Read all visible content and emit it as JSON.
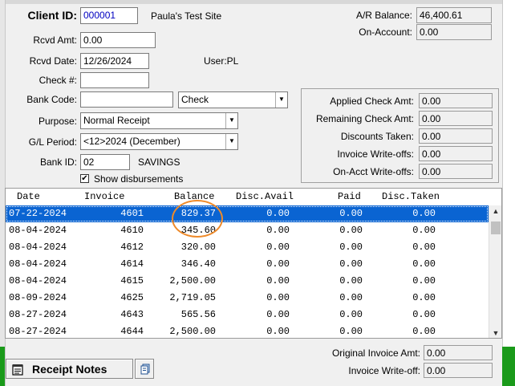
{
  "client": {
    "id_label": "Client ID:",
    "id_value": "000001",
    "site_name": "Paula's Test Site"
  },
  "balances": {
    "ar_label": "A/R Balance:",
    "ar_value": "46,400.61",
    "onaccount_label": "On-Account:",
    "onaccount_value": "0.00"
  },
  "form": {
    "rcvd_amt_label": "Rcvd Amt:",
    "rcvd_amt_value": "0.00",
    "rcvd_date_label": "Rcvd Date:",
    "rcvd_date_value": "12/26/2024",
    "user_text": "User:PL",
    "check_label": "Check #:",
    "check_value": "",
    "bank_code_label": "Bank Code:",
    "bank_code_value": "",
    "payment_type": "Check",
    "purpose_label": "Purpose:",
    "purpose_value": "Normal Receipt",
    "gl_period_label": "G/L Period:",
    "gl_period_value": "<12>2024 (December)",
    "bank_id_label": "Bank ID:",
    "bank_id_value": "02",
    "bank_name": "SAVINGS",
    "show_disb_label": "Show disbursements",
    "show_disb_checked": "✔"
  },
  "summary": {
    "applied_label": "Applied Check Amt:",
    "applied_value": "0.00",
    "remaining_label": "Remaining Check Amt:",
    "remaining_value": "0.00",
    "discounts_label": "Discounts Taken:",
    "discounts_value": "0.00",
    "inv_wo_label": "Invoice Write-offs:",
    "inv_wo_value": "0.00",
    "onacct_wo_label": "On-Acct Write-offs:",
    "onacct_wo_value": "0.00"
  },
  "grid": {
    "headers": {
      "date": "Date",
      "invoice": "Invoice",
      "balance": "Balance",
      "disc_avail": "Disc.Avail",
      "paid": "Paid",
      "disc_taken": "Disc.Taken"
    },
    "rows": [
      {
        "date": "07-22-2024",
        "invoice": "4601",
        "balance": "829.37",
        "disc_avail": "0.00",
        "paid": "0.00",
        "disc_taken": "0.00"
      },
      {
        "date": "08-04-2024",
        "invoice": "4610",
        "balance": "345.60",
        "disc_avail": "0.00",
        "paid": "0.00",
        "disc_taken": "0.00"
      },
      {
        "date": "08-04-2024",
        "invoice": "4612",
        "balance": "320.00",
        "disc_avail": "0.00",
        "paid": "0.00",
        "disc_taken": "0.00"
      },
      {
        "date": "08-04-2024",
        "invoice": "4614",
        "balance": "346.40",
        "disc_avail": "0.00",
        "paid": "0.00",
        "disc_taken": "0.00"
      },
      {
        "date": "08-04-2024",
        "invoice": "4615",
        "balance": "2,500.00",
        "disc_avail": "0.00",
        "paid": "0.00",
        "disc_taken": "0.00"
      },
      {
        "date": "08-09-2024",
        "invoice": "4625",
        "balance": "2,719.05",
        "disc_avail": "0.00",
        "paid": "0.00",
        "disc_taken": "0.00"
      },
      {
        "date": "08-27-2024",
        "invoice": "4643",
        "balance": "565.56",
        "disc_avail": "0.00",
        "paid": "0.00",
        "disc_taken": "0.00"
      },
      {
        "date": "08-27-2024",
        "invoice": "4644",
        "balance": "2,500.00",
        "disc_avail": "0.00",
        "paid": "0.00",
        "disc_taken": "0.00"
      }
    ]
  },
  "footer": {
    "orig_inv_label": "Original Invoice Amt:",
    "orig_inv_value": "0.00",
    "inv_wo_label": "Invoice Write-off:",
    "inv_wo_value": "0.00",
    "notes_button_label": "Receipt Notes"
  },
  "colors": {
    "selection": "#0a64d2",
    "annotation": "#ee8a2a",
    "taskbar_green": "#1a9a1a"
  }
}
